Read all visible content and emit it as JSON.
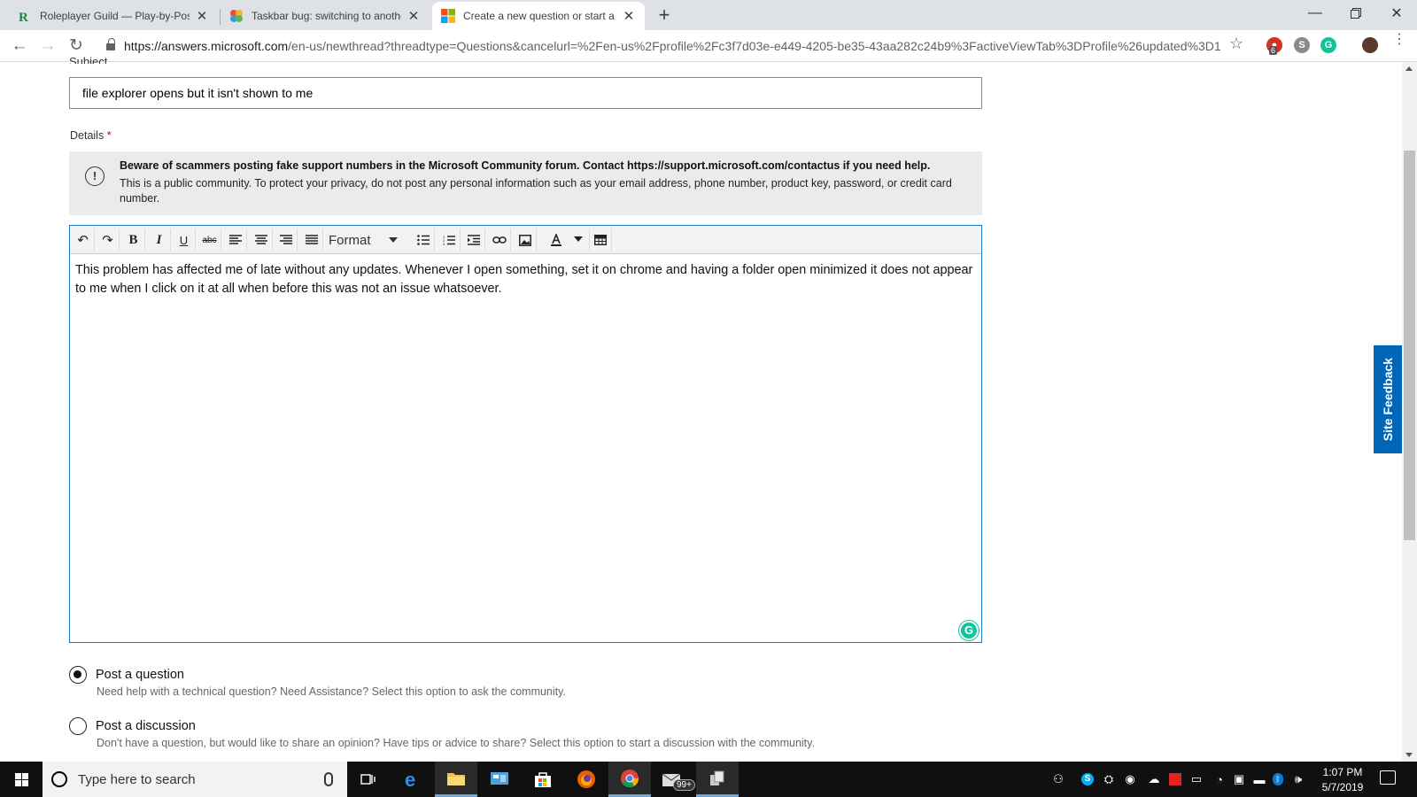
{
  "browser": {
    "tabs": [
      {
        "title": "Roleplayer Guild — Play-by-Post",
        "favicon": "rpg-logo-icon",
        "active": false
      },
      {
        "title": "Taskbar bug: switching to anothe",
        "favicon": "community-icon",
        "active": false
      },
      {
        "title": "Create a new question or start a",
        "favicon": "microsoft-logo-icon",
        "active": true
      }
    ],
    "new_tab_label": "+",
    "url_host": "https://answers.microsoft.com",
    "url_path": "/en-us/newthread?threadtype=Questions&cancelurl=%2Fen-us%2Fprofile%2Fc3f7d03e-e449-4205-be35-43aa282c24b9%3FactiveViewTab%3DProfile%26updated%3D1",
    "extension_badge": "6"
  },
  "form": {
    "subject_label": "Subject",
    "subject_value": "file explorer opens but it isn't shown to me",
    "details_label": "Details",
    "required_mark": "*",
    "notice_title": "Beware of scammers posting fake support numbers in the Microsoft Community forum. Contact https://support.microsoft.com/contactus if you need help.",
    "notice_body": "This is a public community. To protect your privacy, do not post any personal information such as your email address, phone number, product key, password, or credit card number.",
    "toolbar": {
      "format_label": "Format"
    },
    "details_text": "This problem has affected me of late without any updates. Whenever I open something, set it on chrome and having a folder open minimized it does not appear to me when I click on it at all when before this was not an issue whatsoever.",
    "options": [
      {
        "label": "Post a question",
        "description": "Need help with a technical question? Need Assistance? Select this option to ask the community.",
        "selected": true
      },
      {
        "label": "Post a discussion",
        "description": "Don't have a question, but would like to share an opinion? Have tips or advice to share? Select this option to start a discussion with the community.",
        "selected": false
      }
    ]
  },
  "site_feedback_label": "Site Feedback",
  "taskbar": {
    "search_placeholder": "Type here to search",
    "mail_badge": "99+",
    "time": "1:07 PM",
    "date": "5/7/2019"
  },
  "colors": {
    "accent": "#0067b8",
    "editor_border": "#1b78c8",
    "grammarly": "#15c39a",
    "taskbar": "#101010"
  }
}
